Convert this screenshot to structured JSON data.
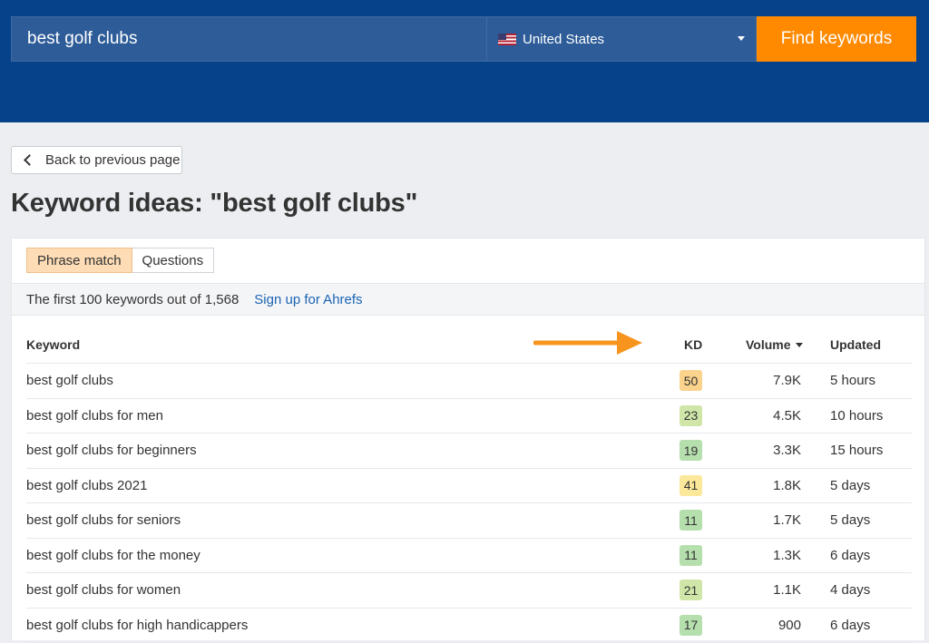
{
  "search": {
    "keyword_value": "best golf clubs",
    "country": "United States",
    "find_label": "Find keywords"
  },
  "back_label": "Back to previous page",
  "page_title": "Keyword ideas: \"best golf clubs\"",
  "tabs": [
    {
      "label": "Phrase match",
      "active": true
    },
    {
      "label": "Questions",
      "active": false
    }
  ],
  "info": {
    "summary": "The first 100 keywords out of 1,568",
    "signup_link": "Sign up for Ahrefs"
  },
  "table": {
    "headers": {
      "keyword": "Keyword",
      "kd": "KD",
      "volume": "Volume",
      "updated": "Updated"
    },
    "rows": [
      {
        "keyword": "best golf clubs",
        "kd": "50",
        "volume": "7.9K",
        "updated": "5 hours",
        "kd_color": "#fbd38d"
      },
      {
        "keyword": "best golf clubs for men",
        "kd": "23",
        "volume": "4.5K",
        "updated": "10 hours",
        "kd_color": "#cfe6a8"
      },
      {
        "keyword": "best golf clubs for beginners",
        "kd": "19",
        "volume": "3.3K",
        "updated": "15 hours",
        "kd_color": "#b6dfae"
      },
      {
        "keyword": "best golf clubs 2021",
        "kd": "41",
        "volume": "1.8K",
        "updated": "5 days",
        "kd_color": "#fbe89a"
      },
      {
        "keyword": "best golf clubs for seniors",
        "kd": "11",
        "volume": "1.7K",
        "updated": "5 days",
        "kd_color": "#b6dfae"
      },
      {
        "keyword": "best golf clubs for the money",
        "kd": "11",
        "volume": "1.3K",
        "updated": "6 days",
        "kd_color": "#b6dfae"
      },
      {
        "keyword": "best golf clubs for women",
        "kd": "21",
        "volume": "1.1K",
        "updated": "4 days",
        "kd_color": "#cfe6a8"
      },
      {
        "keyword": "best golf clubs for high handicappers",
        "kd": "17",
        "volume": "900",
        "updated": "6 days",
        "kd_color": "#b6dfae"
      }
    ]
  },
  "colors": {
    "header_bg": "#054289",
    "accent_orange": "#ff8a00",
    "link_blue": "#1a64b4"
  },
  "icons": {
    "flag": "us-flag-icon",
    "dropdown": "chevron-down-icon",
    "back": "chevron-left-icon",
    "arrow": "arrow-right-icon",
    "sort": "sort-desc-icon"
  }
}
